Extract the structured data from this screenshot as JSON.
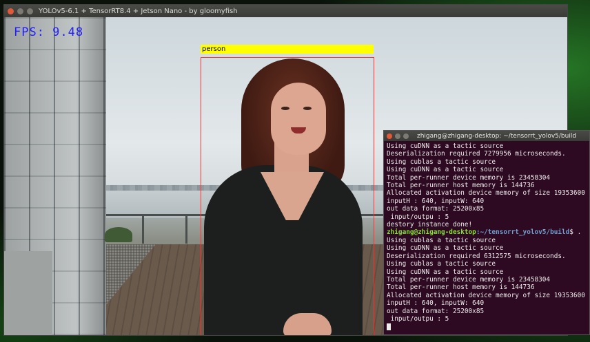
{
  "video_window": {
    "title": "YOLOv5-6.1 + TensorRT8.4 + Jetson Nano - by gloomyfish",
    "fps_text": "FPS: 9.48",
    "detection_label": "person"
  },
  "terminal": {
    "title": "zhigang@zhigang-desktop: ~/tensorrt_yolov5/build",
    "lines_before": [
      "Using cuDNN as a tactic source",
      "Deserialization required 7279956 microseconds.",
      "Using cublas a tactic source",
      "Using cuDNN as a tactic source",
      "Total per-runner device memory is 23458304",
      "Total per-runner host memory is 144736",
      "Allocated activation device memory of size 19353600",
      "inputH : 640, inputW: 640",
      "out data format: 25200x85",
      " input/outpu : 5",
      "destory instance done!"
    ],
    "prompt_user": "zhigang@zhigang-desktop",
    "prompt_path": ":~/tensorrt_yolov5/build",
    "prompt_cmd": "$ .",
    "lines_after": [
      "Using cublas a tactic source",
      "Using cuDNN as a tactic source",
      "Deserialization required 6312575 microseconds.",
      "Using cublas a tactic source",
      "Using cuDNN as a tactic source",
      "Total per-runner device memory is 23458304",
      "Total per-runner host memory is 144736",
      "Allocated activation device memory of size 19353600",
      "inputH : 640, inputW: 640",
      "out data format: 25200x85",
      " input/outpu : 5"
    ]
  }
}
